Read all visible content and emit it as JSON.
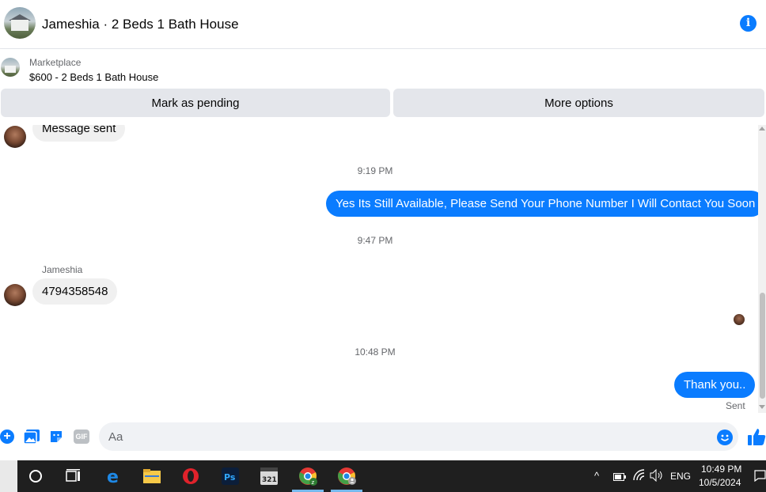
{
  "header": {
    "title": "Jameshia · 2 Beds 1 Bath House",
    "info_icon": "info-icon"
  },
  "marketplace": {
    "label": "Marketplace",
    "item": "$600 - 2 Beds 1 Bath House",
    "buttons": {
      "pending": "Mark as pending",
      "more": "More options"
    }
  },
  "conversation": {
    "messages": [
      {
        "type": "incoming",
        "text": "Message sent"
      },
      {
        "type": "timestamp",
        "text": "9:19 PM"
      },
      {
        "type": "outgoing",
        "text": "Yes Its Still Available, Please Send Your Phone Number I Will Contact You Soon"
      },
      {
        "type": "timestamp",
        "text": "9:47 PM"
      },
      {
        "type": "sender",
        "text": "Jameshia"
      },
      {
        "type": "incoming",
        "text": "4794358548"
      },
      {
        "type": "timestamp",
        "text": "10:48 PM"
      },
      {
        "type": "outgoing",
        "text": "Thank you.."
      }
    ],
    "status": "Sent"
  },
  "composer": {
    "placeholder": "Aa",
    "icons": [
      "plus-icon",
      "photo-icon",
      "sticker-icon",
      "gif-icon",
      "emoji-icon",
      "thumbs-up-icon"
    ],
    "gif_label": "GIF"
  },
  "taskbar": {
    "icons": [
      "cortana-icon",
      "task-view-icon",
      "edge-icon",
      "file-explorer-icon",
      "opera-icon",
      "photoshop-icon",
      "media-player-classic-icon",
      "chrome-profile-icon",
      "chrome-icon"
    ],
    "language": "ENG",
    "time": "10:49 PM",
    "date": "10/5/2024"
  },
  "colors": {
    "accent": "#0a7cff",
    "incoming_bubble": "#f0f0f0",
    "button_bg": "#e4e6eb",
    "taskbar_bg": "#1f1f1f"
  }
}
